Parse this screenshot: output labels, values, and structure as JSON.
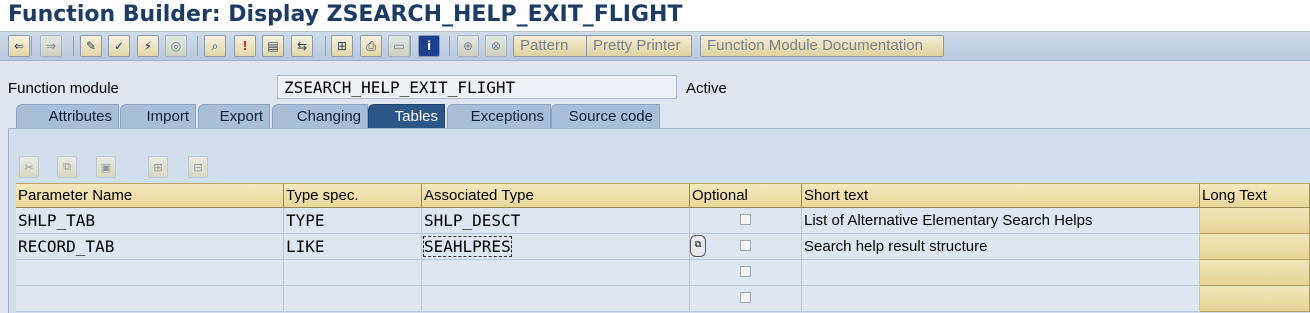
{
  "window": {
    "title": "Function Builder: Display ZSEARCH_HELP_EXIT_FLIGHT"
  },
  "toolbar": {
    "icons": [
      {
        "name": "back-icon",
        "glyph": "⇐",
        "disabled": false
      },
      {
        "name": "forward-icon",
        "glyph": "⇒",
        "disabled": true
      },
      {
        "name": "display-change-icon",
        "glyph": "✎",
        "disabled": false
      },
      {
        "name": "check-icon",
        "glyph": "✓",
        "disabled": false
      },
      {
        "name": "activate-icon",
        "glyph": "⚡",
        "disabled": false
      },
      {
        "name": "test-icon",
        "glyph": "◎",
        "disabled": true
      },
      {
        "name": "where-used-icon",
        "glyph": "⌕",
        "disabled": false
      },
      {
        "name": "breakpoint-icon",
        "glyph": "!",
        "disabled": false
      },
      {
        "name": "display-object-list-icon",
        "glyph": "▤",
        "disabled": false
      },
      {
        "name": "navigation-window-icon",
        "glyph": "⇆",
        "disabled": false
      },
      {
        "name": "hierarchy-icon",
        "glyph": "⊞",
        "disabled": false
      },
      {
        "name": "print-icon",
        "glyph": "⎙",
        "disabled": false
      },
      {
        "name": "help-icon",
        "glyph": "▭",
        "disabled": true
      },
      {
        "name": "info-icon",
        "glyph": "i",
        "disabled": false
      },
      {
        "name": "insert-icon",
        "glyph": "⊕",
        "disabled": true
      },
      {
        "name": "replace-icon",
        "glyph": "⊗",
        "disabled": true
      }
    ],
    "pattern_label": "Pattern",
    "pretty_printer_label": "Pretty Printer",
    "fm_doc_label": "Function Module Documentation"
  },
  "function_module": {
    "label": "Function module",
    "value": "ZSEARCH_HELP_EXIT_FLIGHT",
    "status": "Active"
  },
  "tabs": [
    {
      "label": "Attributes",
      "active": false
    },
    {
      "label": "Import",
      "active": false
    },
    {
      "label": "Export",
      "active": false
    },
    {
      "label": "Changing",
      "active": false
    },
    {
      "label": "Tables",
      "active": true
    },
    {
      "label": "Exceptions",
      "active": false
    },
    {
      "label": "Source code",
      "active": false
    }
  ],
  "table_toolbar": [
    {
      "name": "cut-icon",
      "glyph": "✂"
    },
    {
      "name": "copy-icon",
      "glyph": "⧉"
    },
    {
      "name": "paste-icon",
      "glyph": "▣"
    },
    {
      "name": "insert-row-icon",
      "glyph": "⊞"
    },
    {
      "name": "delete-row-icon",
      "glyph": "⊟"
    }
  ],
  "table": {
    "headers": [
      "Parameter Name",
      "Type spec.",
      "Associated Type",
      "Optional",
      "Short text",
      "Long Text"
    ],
    "rows": [
      {
        "name": "SHLP_TAB",
        "type_spec": "TYPE",
        "assoc_type": "SHLP_DESCT",
        "optional": false,
        "short_text": "List of Alternative Elementary Search Helps"
      },
      {
        "name": "RECORD_TAB",
        "type_spec": "LIKE",
        "assoc_type": "SEAHLPRES",
        "optional": false,
        "short_text": "Search help result structure"
      },
      {
        "name": "",
        "type_spec": "",
        "assoc_type": "",
        "optional": false,
        "short_text": ""
      },
      {
        "name": "",
        "type_spec": "",
        "assoc_type": "",
        "optional": false,
        "short_text": ""
      }
    ]
  }
}
